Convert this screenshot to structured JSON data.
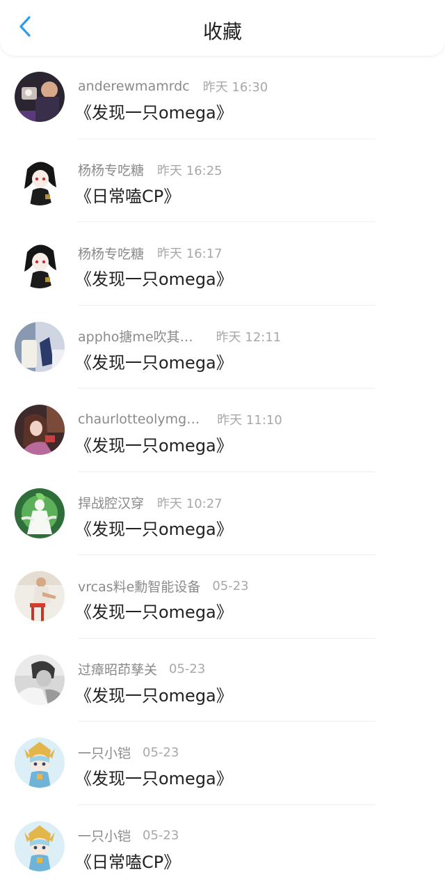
{
  "header": {
    "title": "收藏",
    "back_icon": "chevron-left-icon",
    "accent": "#2d9cf0"
  },
  "items": [
    {
      "name": "anderewmamrdc",
      "time": "昨天 16:30",
      "work": "《发现一只omega》",
      "avatar": "photo-man-avatar"
    },
    {
      "name": "杨杨专吃糖",
      "time": "昨天 16:25",
      "work": "《日常嗑CP》",
      "avatar": "anime-girl-avatar"
    },
    {
      "name": "杨杨专吃糖",
      "time": "昨天 16:17",
      "work": "《发现一只omega》",
      "avatar": "anime-girl-avatar"
    },
    {
      "name": "appho搪me吹其…",
      "time": "昨天 12:11",
      "work": "《发现一只omega》",
      "avatar": "photo-figure-avatar"
    },
    {
      "name": "chaurlotteolymg…",
      "time": "昨天 11:10",
      "work": "《发现一只omega》",
      "avatar": "photo-girl-avatar"
    },
    {
      "name": "捍战腔汉穿",
      "time": "昨天 10:27",
      "work": "《发现一只omega》",
      "avatar": "green-creature-avatar"
    },
    {
      "name": "vrcas料e勳智能设备",
      "time": "05-23",
      "work": "《发现一只omega》",
      "avatar": "painting-avatar"
    },
    {
      "name": "过瘴昭茚孳关",
      "time": "05-23",
      "work": "《发现一只omega》",
      "avatar": "grayscale-photo-avatar"
    },
    {
      "name": "一只小铠",
      "time": "05-23",
      "work": "《发现一只omega》",
      "avatar": "chibi-knight-avatar"
    },
    {
      "name": "一只小铠",
      "time": "05-23",
      "work": "《日常嗑CP》",
      "avatar": "chibi-knight-avatar"
    }
  ]
}
